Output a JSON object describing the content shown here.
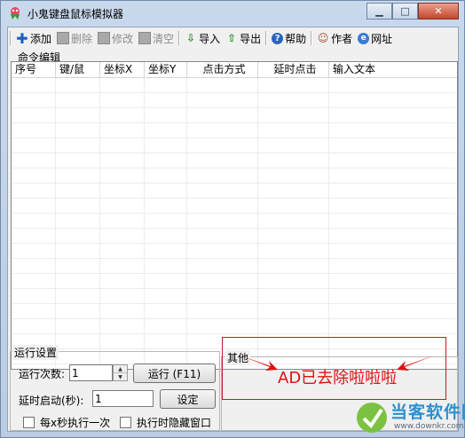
{
  "window": {
    "title": "小鬼键盘鼠标模拟器"
  },
  "toolbar": {
    "items": [
      {
        "label": "添加",
        "icon": "plus-icon",
        "enabled": true
      },
      {
        "label": "删除",
        "icon": "delete-icon",
        "enabled": false
      },
      {
        "label": "修改",
        "icon": "edit-icon",
        "enabled": false
      },
      {
        "label": "清空",
        "icon": "clear-icon",
        "enabled": false
      },
      {
        "label": "导入",
        "icon": "import-icon",
        "enabled": true
      },
      {
        "label": "导出",
        "icon": "export-icon",
        "enabled": true
      },
      {
        "label": "帮助",
        "icon": "help-icon",
        "enabled": true
      },
      {
        "label": "作者",
        "icon": "author-icon",
        "enabled": true
      },
      {
        "label": "网址",
        "icon": "globe-icon",
        "enabled": true
      }
    ]
  },
  "command_group": {
    "legend": "命令编辑",
    "columns": [
      "序号",
      "键/鼠",
      "坐标X",
      "坐标Y",
      "点击方式",
      "延时点击",
      "输入文本"
    ]
  },
  "run_settings": {
    "legend": "运行设置",
    "run_count_label": "运行次数:",
    "run_count_value": "1",
    "run_button": "运行 (F11)",
    "delay_label": "延时启动(秒):",
    "delay_value": "1",
    "set_button": "设定",
    "every_x_label": "每x秒执行一次",
    "hide_label": "执行时隐藏窗口"
  },
  "other": {
    "legend": "其他",
    "ad_text": "AD已去除啦啦啦"
  },
  "watermark": {
    "title": "当客软件园",
    "url": "www.downkr.com"
  },
  "colors": {
    "accent": "#2a8fd0",
    "ad_red": "#e01010",
    "title_bar": "#c9d9ec"
  }
}
